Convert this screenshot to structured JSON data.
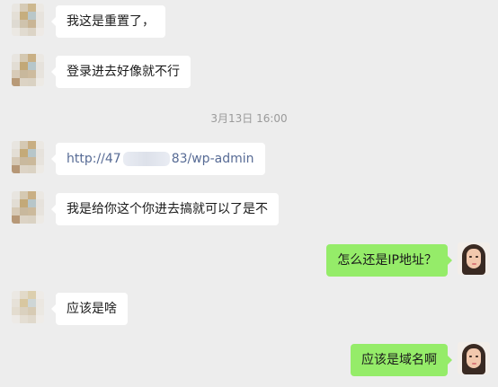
{
  "timestamp": "3月13日 16:00",
  "messages": [
    {
      "side": "left",
      "text": "我这是重置了，"
    },
    {
      "side": "left",
      "text": "登录进去好像就不行"
    },
    {
      "side": "left",
      "link_prefix": "http://47",
      "link_suffix": "83/wp-admin"
    },
    {
      "side": "left",
      "text": "我是给你这个你进去搞就可以了是不"
    },
    {
      "side": "right",
      "text": "怎么还是IP地址？"
    },
    {
      "side": "left",
      "text": "应该是啥"
    },
    {
      "side": "right",
      "text": "应该是域名啊"
    }
  ],
  "colors": {
    "background": "#ededed",
    "bubble_received": "#ffffff",
    "bubble_sent": "#95ec69",
    "link": "#576b95"
  },
  "icons": {
    "contact_avatar": "mosaic-avatar-icon",
    "self_avatar": "woman-face-avatar-icon"
  }
}
